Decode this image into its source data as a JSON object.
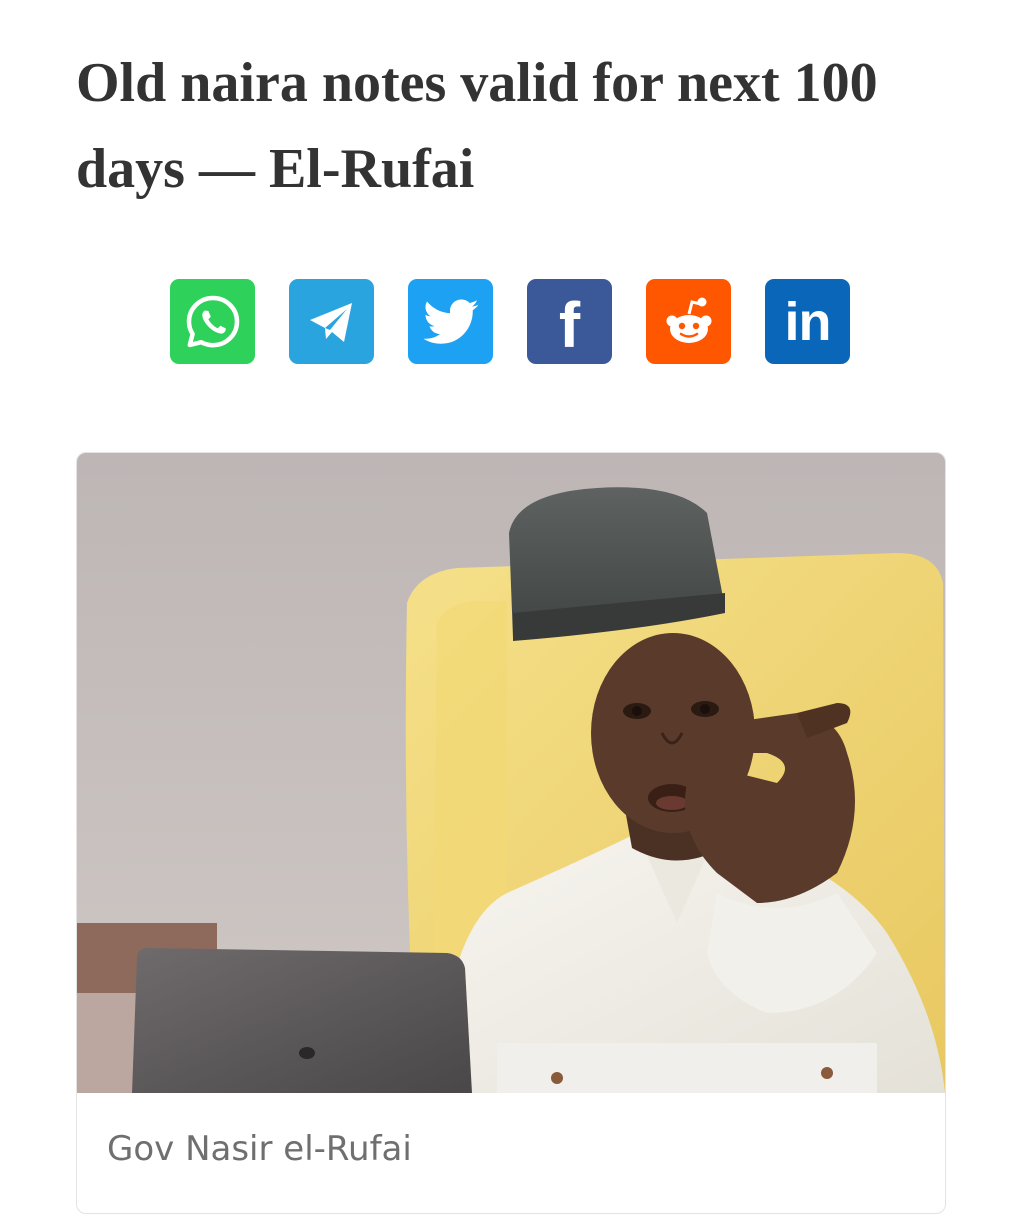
{
  "article": {
    "title": "Old naira notes valid for next 100 days — El-Rufai"
  },
  "share": {
    "buttons": [
      {
        "name": "whatsapp",
        "icon": "whatsapp-icon",
        "color": "#2ED15A"
      },
      {
        "name": "telegram",
        "icon": "telegram-icon",
        "color": "#2AA4DF"
      },
      {
        "name": "twitter",
        "icon": "twitter-icon",
        "color": "#1DA1F2"
      },
      {
        "name": "facebook",
        "icon": "facebook-icon",
        "color": "#3B5998"
      },
      {
        "name": "reddit",
        "icon": "reddit-icon",
        "color": "#FF5700"
      },
      {
        "name": "linkedin",
        "icon": "linkedin-icon",
        "color": "#0A66B8"
      }
    ],
    "facebook_glyph": "f",
    "linkedin_glyph": "in"
  },
  "image": {
    "caption": "Gov Nasir el-Rufai"
  }
}
